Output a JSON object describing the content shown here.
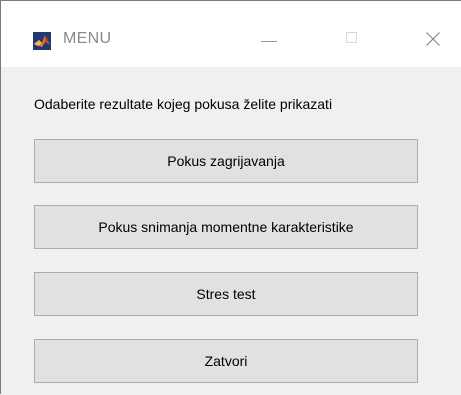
{
  "window": {
    "title": "MENU",
    "app_icon": "matlab-icon",
    "controls": {
      "minimize_icon": "minimize-icon",
      "maximize_icon": "maximize-icon",
      "close_icon": "close-icon"
    }
  },
  "content": {
    "prompt": "Odaberite rezultate kojeg pokusa želite prikazati",
    "buttons": [
      {
        "label": "Pokus zagrijavanja"
      },
      {
        "label": "Pokus snimanja momentne karakteristike"
      },
      {
        "label": "Stres test"
      },
      {
        "label": "Zatvori"
      }
    ]
  },
  "colors": {
    "titlebar": "#ffffff",
    "body_background": "#f0f0f0",
    "button_face": "#e1e1e1",
    "button_border": "#adadad",
    "title_text": "#8a8a8a"
  }
}
